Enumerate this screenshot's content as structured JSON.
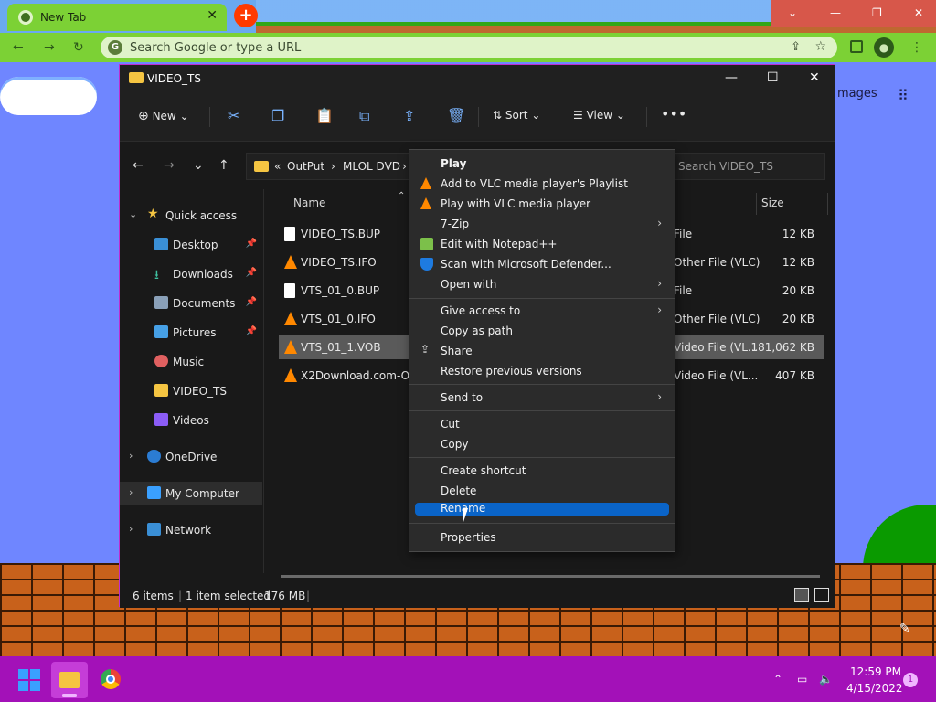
{
  "browser": {
    "tab_title": "New Tab",
    "omnibox_placeholder": "Search Google or type a URL",
    "images_link": "mages"
  },
  "window": {
    "title": "VIDEO_TS",
    "ribbon": {
      "new_label": "New",
      "sort_label": "Sort",
      "view_label": "View"
    },
    "address": {
      "prefix": "«",
      "crumbs": [
        "OutPut",
        "MLOL DVD"
      ]
    },
    "search_placeholder": "Search VIDEO_TS",
    "nav": [
      {
        "label": "Quick access"
      },
      {
        "label": "Desktop"
      },
      {
        "label": "Downloads"
      },
      {
        "label": "Documents"
      },
      {
        "label": "Pictures"
      },
      {
        "label": "Music"
      },
      {
        "label": "VIDEO_TS"
      },
      {
        "label": "Videos"
      },
      {
        "label": "OneDrive"
      },
      {
        "label": "My Computer"
      },
      {
        "label": "Network"
      }
    ],
    "columns": {
      "name": "Name",
      "size": "Size"
    },
    "files": [
      {
        "name": "VIDEO_TS.BUP",
        "type": "File",
        "size": "12 KB"
      },
      {
        "name": "VIDEO_TS.IFO",
        "type": "Other File (VLC)",
        "size": "12 KB"
      },
      {
        "name": "VTS_01_0.BUP",
        "type": "File",
        "size": "20 KB"
      },
      {
        "name": "VTS_01_0.IFO",
        "type": "Other File (VLC)",
        "size": "20 KB"
      },
      {
        "name": "VTS_01_1.VOB",
        "type": "Video File (VL...",
        "size": "181,062 KB"
      },
      {
        "name": "X2Download.com-Occ",
        "type": "Video File (VL...",
        "size": "407 KB"
      }
    ],
    "status": {
      "items": "6 items",
      "selected": "1 item selected",
      "size": "176 MB"
    }
  },
  "context_menu": {
    "items": [
      {
        "label": "Play"
      },
      {
        "label": "Add to VLC media player's Playlist"
      },
      {
        "label": "Play with VLC media player"
      },
      {
        "label": "7-Zip"
      },
      {
        "label": "Edit with Notepad++"
      },
      {
        "label": "Scan with Microsoft Defender..."
      },
      {
        "label": "Open with"
      },
      {
        "label": "Give access to"
      },
      {
        "label": "Copy as path"
      },
      {
        "label": "Share"
      },
      {
        "label": "Restore previous versions"
      },
      {
        "label": "Send to"
      },
      {
        "label": "Cut"
      },
      {
        "label": "Copy"
      },
      {
        "label": "Create shortcut"
      },
      {
        "label": "Delete"
      },
      {
        "label": "Rename"
      },
      {
        "label": "Properties"
      }
    ]
  },
  "taskbar": {
    "time": "12:59 PM",
    "date": "4/15/2022",
    "notification_count": "1"
  },
  "colors": {
    "accent": "#0a64c8",
    "taskbar": "#a311b8",
    "folder": "#f5c542",
    "vlc": "#ff8800"
  }
}
